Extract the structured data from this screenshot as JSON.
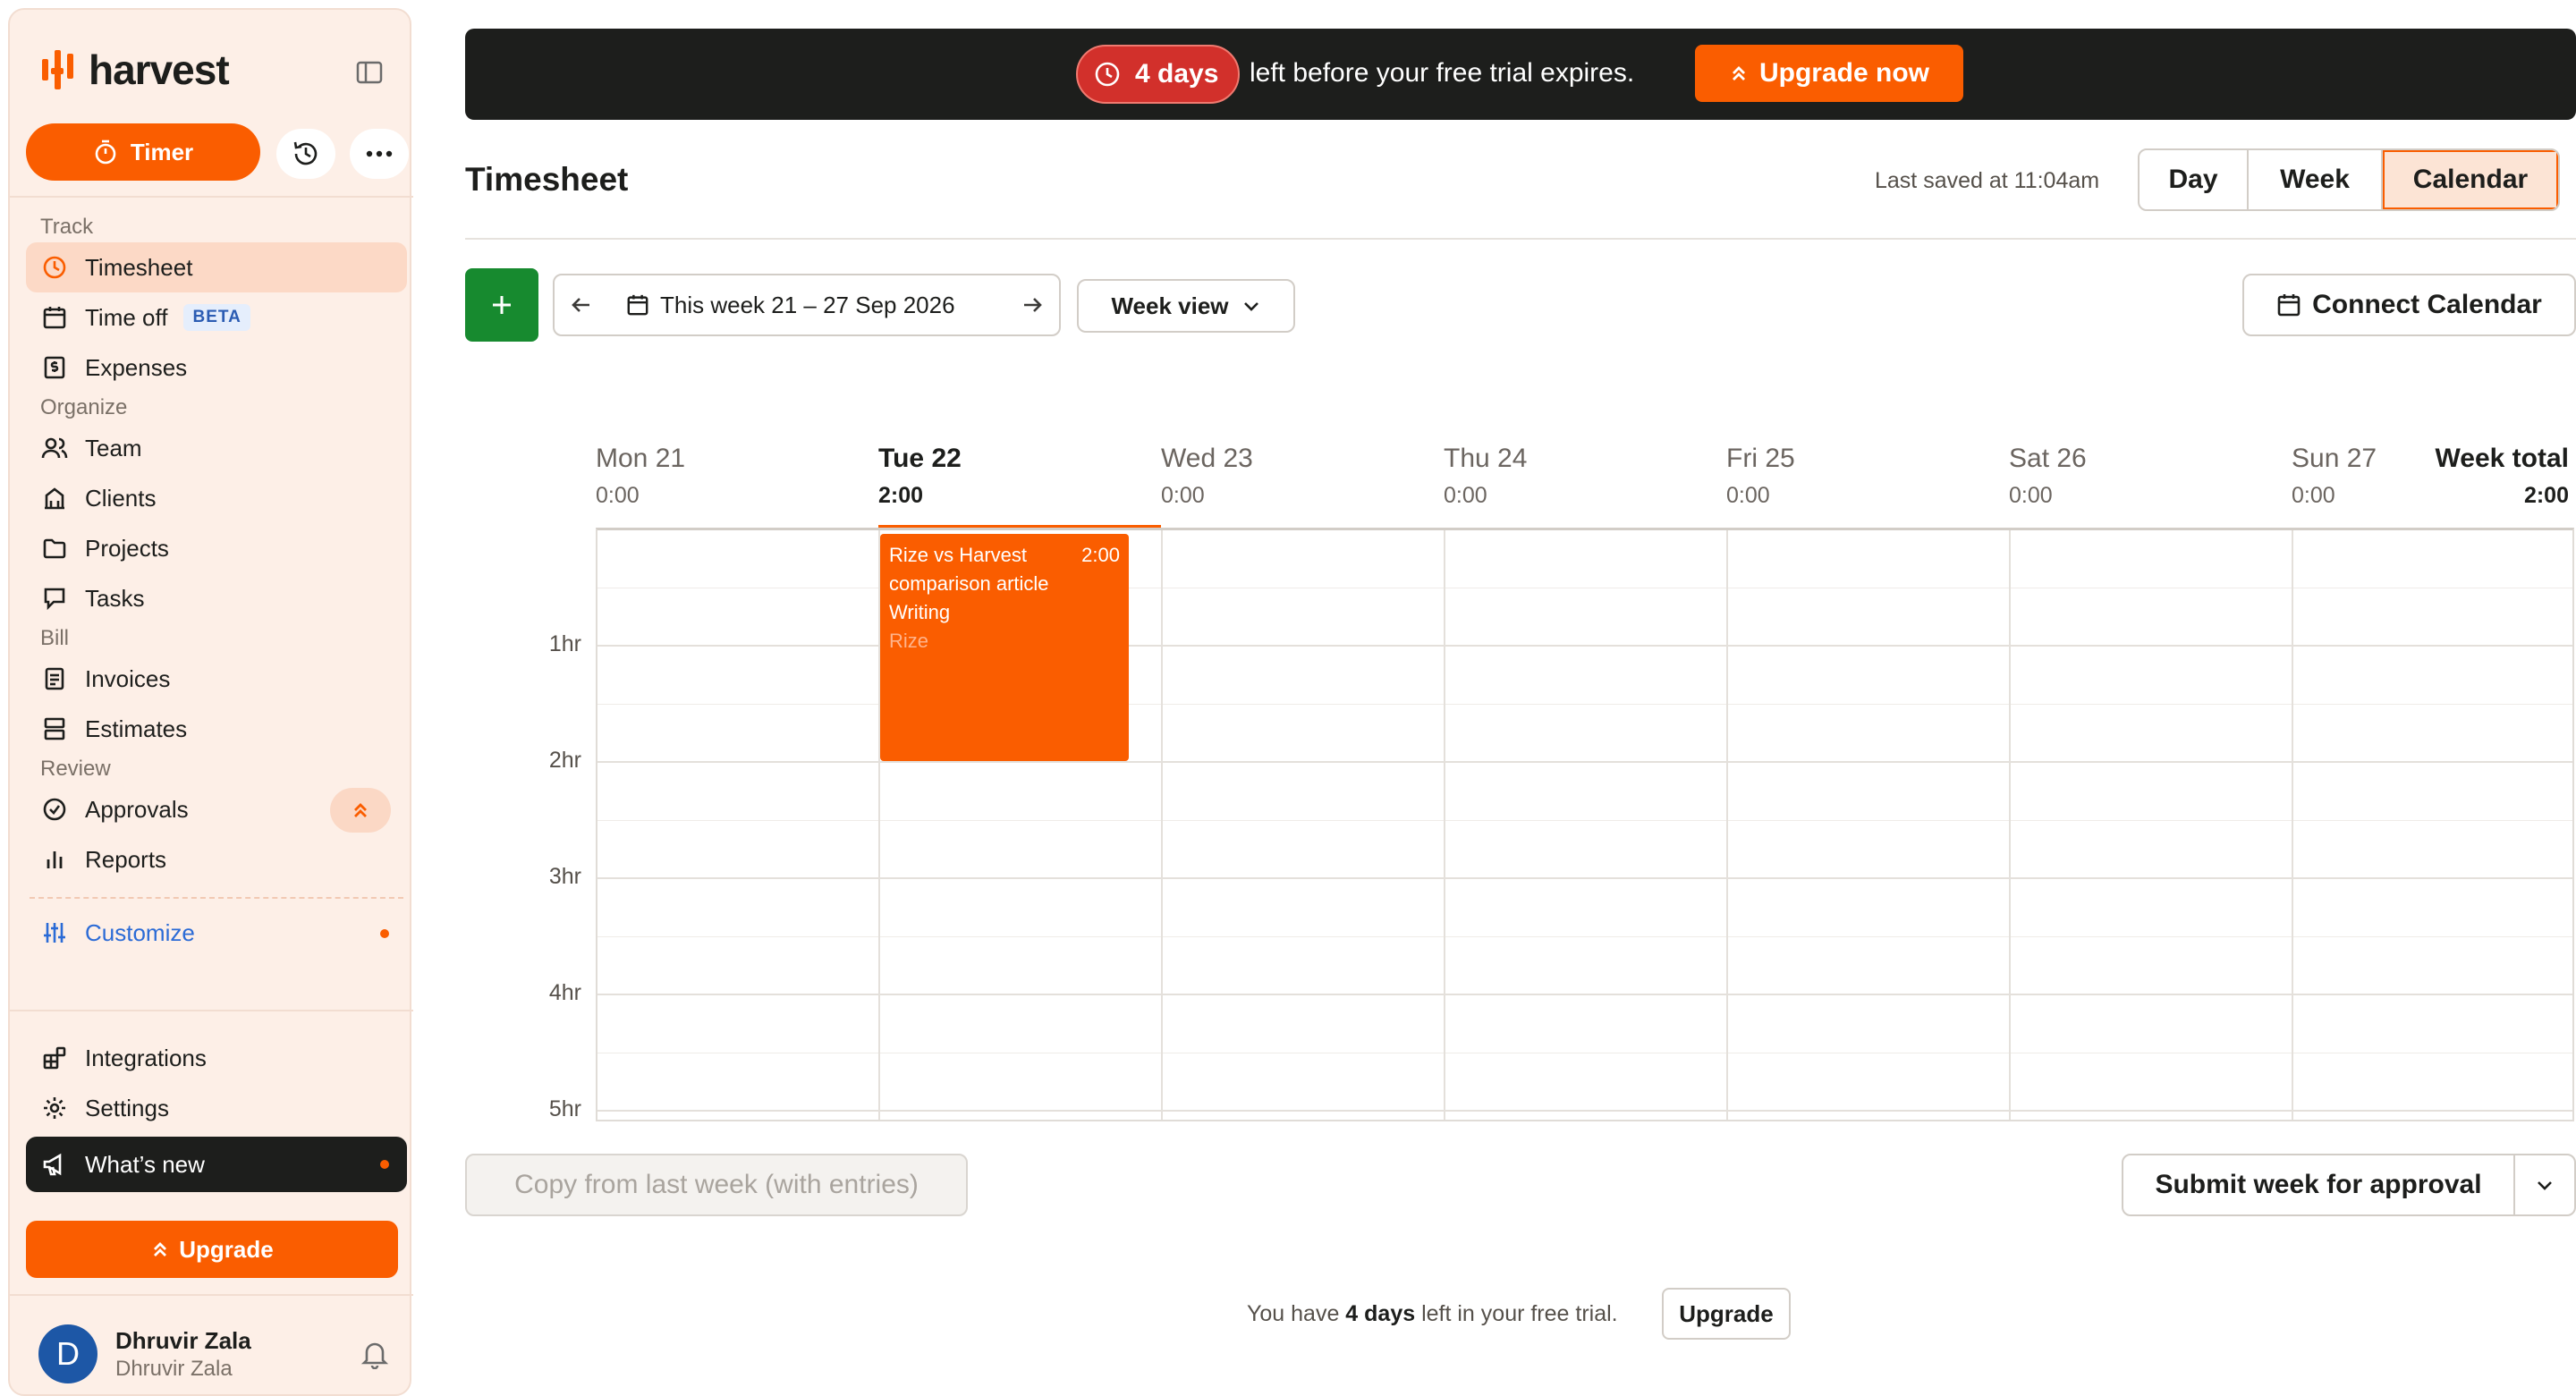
{
  "brand": {
    "name": "harvest",
    "accent": "#fa5d00",
    "dark": "#1d1e1c",
    "add_green": "#178a2f"
  },
  "sidebar": {
    "timer_label": "Timer",
    "sections": {
      "track": "Track",
      "organize": "Organize",
      "bill": "Bill",
      "review": "Review"
    },
    "items": {
      "timesheet": "Timesheet",
      "time_off": "Time off",
      "time_off_badge": "BETA",
      "expenses": "Expenses",
      "team": "Team",
      "clients": "Clients",
      "projects": "Projects",
      "tasks": "Tasks",
      "invoices": "Invoices",
      "estimates": "Estimates",
      "approvals": "Approvals",
      "reports": "Reports",
      "customize": "Customize",
      "integrations": "Integrations",
      "settings": "Settings",
      "whats_new": "What’s new"
    },
    "upgrade_label": "Upgrade",
    "user": {
      "initial": "D",
      "name": "Dhruvir Zala",
      "subtitle": "Dhruvir Zala"
    }
  },
  "banner": {
    "days_left": "4 days",
    "message": "left before your free trial expires.",
    "upgrade_label": "Upgrade now"
  },
  "header": {
    "title": "Timesheet",
    "last_saved": "Last saved at 11:04am",
    "views": [
      "Day",
      "Week",
      "Calendar"
    ],
    "active_view": "Calendar"
  },
  "toolbar": {
    "range_label": "This week 21 – 27 Sep 2026",
    "view_select": "Week view",
    "connect_calendar": "Connect Calendar"
  },
  "calendar": {
    "days": [
      {
        "name": "Mon 21",
        "total": "0:00"
      },
      {
        "name": "Tue 22",
        "total": "2:00",
        "today": true
      },
      {
        "name": "Wed 23",
        "total": "0:00"
      },
      {
        "name": "Thu 24",
        "total": "0:00"
      },
      {
        "name": "Fri 25",
        "total": "0:00"
      },
      {
        "name": "Sat 26",
        "total": "0:00"
      },
      {
        "name": "Sun 27",
        "total": "0:00"
      }
    ],
    "week_total_label": "Week total",
    "week_total": "2:00",
    "hour_labels": [
      "1hr",
      "2hr",
      "3hr",
      "4hr",
      "5hr"
    ],
    "entry": {
      "day": "Tue 22",
      "project": "Rize vs Harvest comparison article",
      "task": "Writing",
      "client": "Rize",
      "duration": "2:00"
    }
  },
  "footer": {
    "copy_label": "Copy from last week (with entries)",
    "submit_label": "Submit week for approval",
    "trial_prefix": "You have ",
    "trial_days": "4 days",
    "trial_suffix": " left in your free trial.",
    "upgrade_label": "Upgrade"
  }
}
